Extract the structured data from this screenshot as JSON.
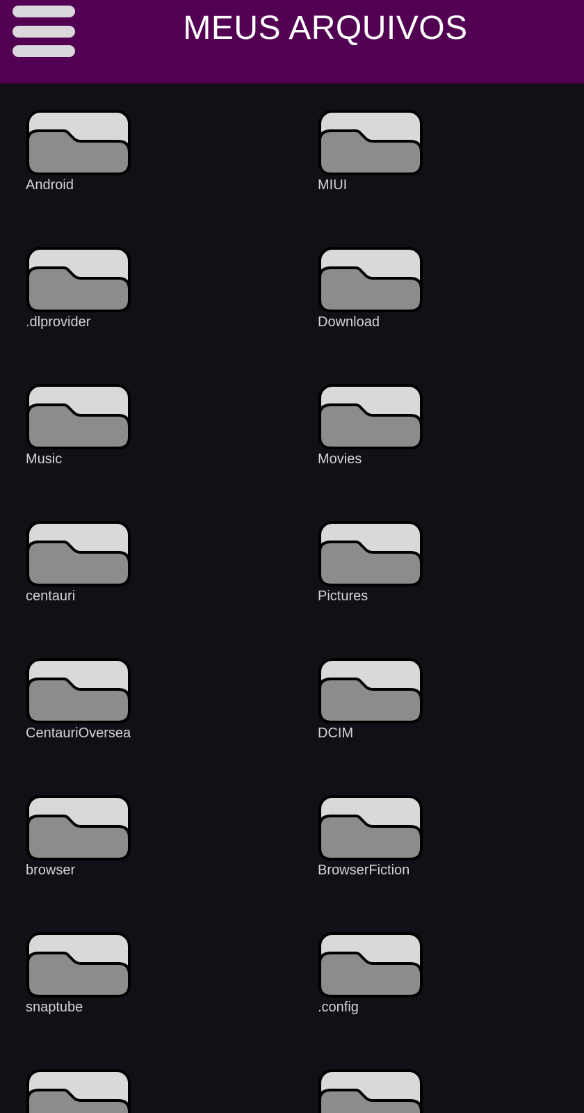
{
  "header": {
    "title": "MEUS ARQUIVOS",
    "menu_icon": "hamburger-menu-icon",
    "background_color": "#520052"
  },
  "folders": [
    {
      "name": "Android"
    },
    {
      "name": "MIUI"
    },
    {
      "name": ".dlprovider"
    },
    {
      "name": "Download"
    },
    {
      "name": "Music"
    },
    {
      "name": "Movies"
    },
    {
      "name": "centauri"
    },
    {
      "name": "Pictures"
    },
    {
      "name": "CentauriOversea"
    },
    {
      "name": "DCIM"
    },
    {
      "name": "browser"
    },
    {
      "name": "BrowserFiction"
    },
    {
      "name": "snaptube"
    },
    {
      "name": ".config"
    },
    {
      "name": ""
    },
    {
      "name": ""
    }
  ],
  "icons": {
    "folder": "folder-icon"
  },
  "colors": {
    "background": "#121016",
    "folder_front": "#8c8c8c",
    "folder_back": "#d9d9d9",
    "folder_outline": "#000000",
    "label_text": "#d4d4d8"
  }
}
